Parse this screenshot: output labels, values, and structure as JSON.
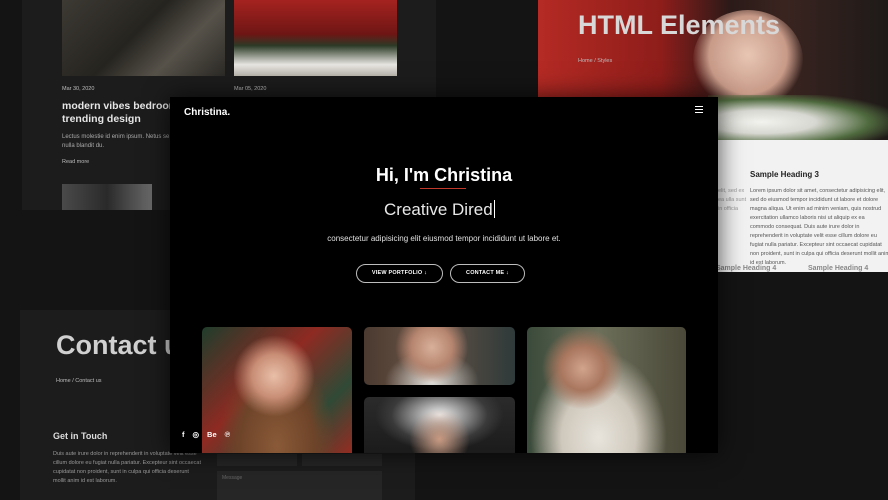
{
  "background": {
    "blog": {
      "date1": "Mar 30, 2020",
      "date2": "Mar 05, 2020",
      "title": "modern vibes bedroom trending design",
      "excerpt": "Lectus molestie id enim ipsum. Netus se ipsum turpis nulla blandit du.",
      "read_more": "Read more"
    },
    "elements": {
      "title": "HTML Elements",
      "breadcrumb": "Home / Styles",
      "heading3": "Sample Heading 3",
      "text": "Lorem ipsum dolor sit amet, consectetur adipisicing elit, sed do eiusmod tempor incididunt ut labore et dolore magna aliqua. Ut enim ad minim veniam, quis nostrud exercitation ullamco laboris nisi ut aliquip ex ea commodo consequat. Duis aute irure dolor in reprehenderit in voluptate velit esse cillum dolore eu fugiat nulla pariatur. Excepteur sint occaecat cupidatat non proident, sunt in culpa qui officia deserunt mollit anim id est laborum.",
      "side_text": "elit, sed ex ea ulla sunt in officia",
      "heading4a": "Sample Heading 4",
      "heading4b": "Sample Heading 4"
    },
    "contact": {
      "title": "Contact us",
      "breadcrumb": "Home / Contact us",
      "get_in_touch": "Get in Touch",
      "text": "Duis aute irure dolor in reprehenderit in voluptate velit esse cillum dolore eu fugiat nulla pariatur. Excepteur sint occaecat cupidatat non proident, sunt in culpa qui officia deserunt mollit anim id est laborum.",
      "message_placeholder": "Message"
    }
  },
  "main": {
    "brand": "Christina.",
    "greeting": "Hi, I'm Christina",
    "typed_text": "Creative Dired",
    "tagline": "consectetur adipisicing elit eiusmod tempor incididunt ut labore et.",
    "buttons": {
      "portfolio": "VIEW PORTFOLIO ↓",
      "contact": "CONTACT ME ↓"
    },
    "social": [
      "f",
      "◎",
      "Be",
      "℗"
    ]
  },
  "colors": {
    "accent": "#c0392b",
    "background": "#000000"
  }
}
